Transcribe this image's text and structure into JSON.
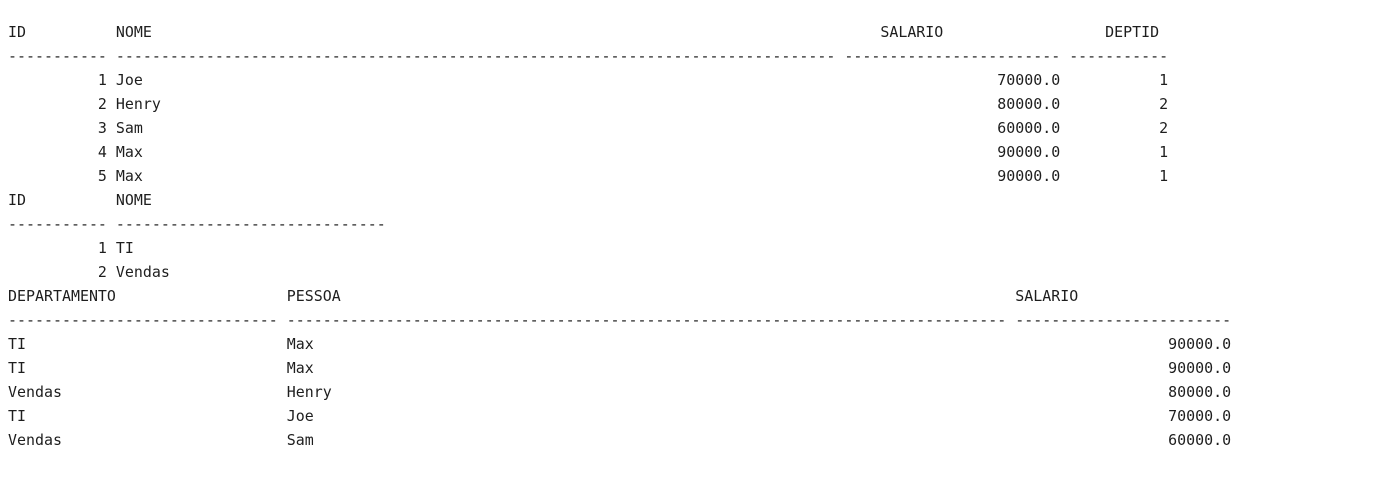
{
  "output": {
    "lines": [
      "ID          NOME                                                                                 SALARIO                  DEPTID",
      "----------- -------------------------------------------------------------------------------- ------------------------ -----------",
      "          1 Joe                                                                                               70000.0           1",
      "          2 Henry                                                                                             80000.0           2",
      "          3 Sam                                                                                               60000.0           2",
      "          4 Max                                                                                               90000.0           1",
      "          5 Max                                                                                               90000.0           1",
      "ID          NOME",
      "----------- ------------------------------",
      "          1 TI",
      "          2 Vendas",
      "DEPARTAMENTO                   PESSOA                                                                           SALARIO",
      "------------------------------ -------------------------------------------------------------------------------- ------------------------",
      "TI                             Max                                                                                               90000.0",
      "TI                             Max                                                                                               90000.0",
      "Vendas                         Henry                                                                                             80000.0",
      "TI                             Joe                                                                                               70000.0",
      "Vendas                         Sam                                                                                               60000.0"
    ]
  }
}
